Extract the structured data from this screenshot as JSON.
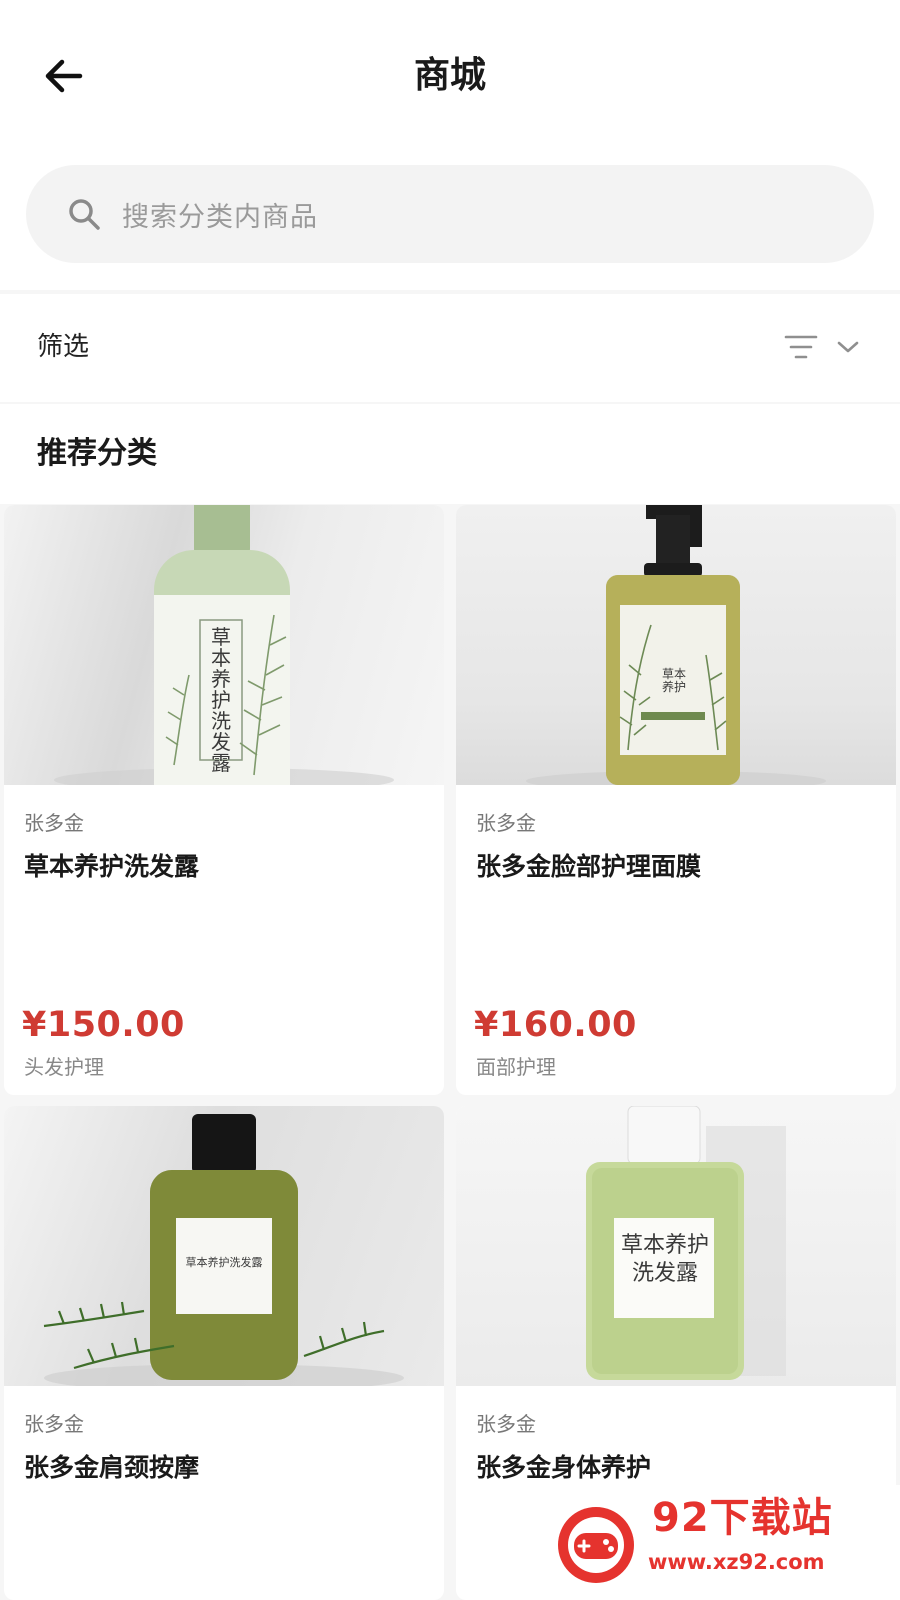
{
  "header": {
    "title": "商城"
  },
  "search": {
    "placeholder": "搜索分类内商品"
  },
  "filter": {
    "label": "筛选"
  },
  "section": {
    "title": "推荐分类"
  },
  "products": [
    {
      "brand": "张多金",
      "name": "草本养护洗发露",
      "price": "¥150.00",
      "category": "头发护理",
      "label_text": "草本养护洗发露"
    },
    {
      "brand": "张多金",
      "name": "张多金脸部护理面膜",
      "price": "¥160.00",
      "category": "面部护理",
      "label_text": "草本养护"
    },
    {
      "brand": "张多金",
      "name": "张多金肩颈按摩",
      "label_text": "草本养护洗发露"
    },
    {
      "brand": "张多金",
      "name": "张多金身体养护",
      "label_text": "草本养护洗发露"
    }
  ],
  "watermark": {
    "title": "92下载站",
    "url": "www.xz92.com"
  },
  "colors": {
    "price": "#cf3b33",
    "background": "#f6f6f6",
    "watermark": "#e5332e"
  },
  "icons": [
    "back-arrow-icon",
    "search-icon",
    "sort-lines-icon",
    "chevron-down-icon"
  ]
}
